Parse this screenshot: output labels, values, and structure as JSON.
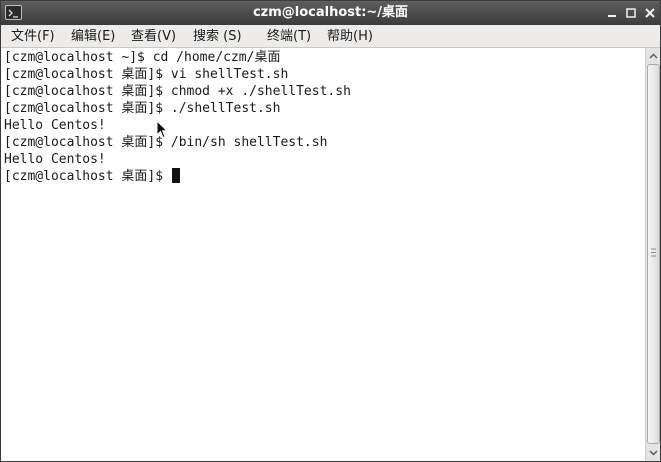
{
  "window": {
    "title": "czm@localhost:~/桌面"
  },
  "menu": {
    "file": "文件(F)",
    "edit": "编辑(E)",
    "view": "查看(V)",
    "search": "搜索 (S)",
    "terminal": "终端(T)",
    "help": "帮助(H)"
  },
  "terminal": {
    "lines": [
      "[czm@localhost ~]$ cd /home/czm/桌面",
      "[czm@localhost 桌面]$ vi shellTest.sh",
      "[czm@localhost 桌面]$ chmod +x ./shellTest.sh",
      "[czm@localhost 桌面]$ ./shellTest.sh",
      "Hello Centos!",
      "[czm@localhost 桌面]$ /bin/sh shellTest.sh",
      "Hello Centos!",
      "[czm@localhost 桌面]$ "
    ]
  },
  "icons": {
    "title": "terminal-icon",
    "minimize": "minimize-icon",
    "maximize": "maximize-icon",
    "close": "close-icon",
    "scroll_up": "chevron-up-icon",
    "scroll_down": "chevron-down-icon",
    "pointer": "mouse-pointer-icon"
  },
  "colors": {
    "titlebar": "#3b3b3b",
    "terminal_bg": "#ffffff",
    "terminal_text": "#1a1a1a"
  }
}
